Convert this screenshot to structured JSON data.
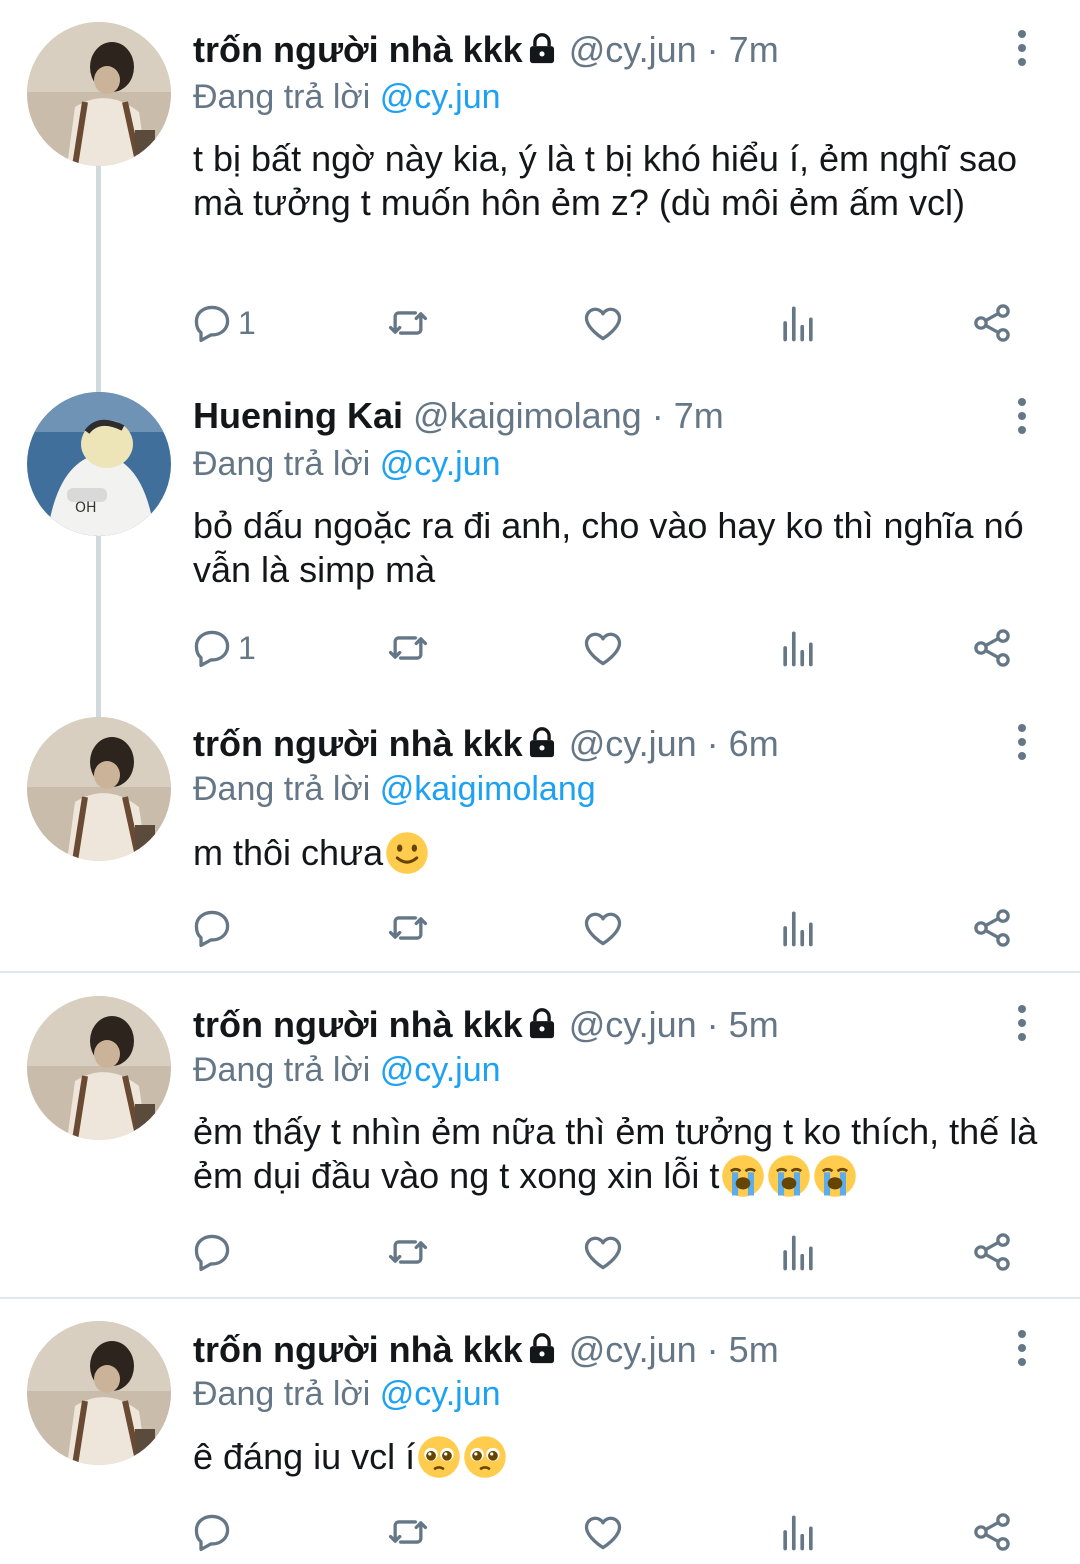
{
  "colors": {
    "accent": "#1da1f2",
    "muted": "#657786",
    "text": "#14171a",
    "divider": "#e1e8ed"
  },
  "tweets": [
    {
      "name": "trốn người nhà kkk",
      "protected_icon": "lock-icon",
      "handle": "@cy.jun",
      "separator": "·",
      "time": "7m",
      "replying_prefix": "Đang trả lời ",
      "replying_to": "@cy.jun",
      "text": "t bị bất ngờ này kia, ý là t bị khó hiểu í, ẻm nghĩ sao mà tưởng t muốn hôn ẻm z? (dù môi ẻm ấm vcl)",
      "emojis": [],
      "reply_count": "1",
      "avatar": "avatar-boy-sepia"
    },
    {
      "name": "Huening Kai",
      "protected_icon": "",
      "handle": "@kaigimolang",
      "separator": "·",
      "time": "7m",
      "replying_prefix": "Đang trả lời ",
      "replying_to": "@cy.jun",
      "text": "bỏ dấu ngoặc ra đi anh, cho vào hay ko thì nghĩa nó vẫn là simp mà",
      "emojis": [],
      "reply_count": "1",
      "avatar": "avatar-blond-white-hoodie"
    },
    {
      "name": "trốn người nhà kkk",
      "protected_icon": "lock-icon",
      "handle": "@cy.jun",
      "separator": "·",
      "time": "6m",
      "replying_prefix": "Đang trả lời ",
      "replying_to": "@kaigimolang",
      "text": "m thôi chưa",
      "emojis": [
        "slightly-smiling-face"
      ],
      "reply_count": "",
      "avatar": "avatar-boy-sepia"
    },
    {
      "name": "trốn người nhà kkk",
      "protected_icon": "lock-icon",
      "handle": "@cy.jun",
      "separator": "·",
      "time": "5m",
      "replying_prefix": "Đang trả lời ",
      "replying_to": "@cy.jun",
      "text": "ẻm thấy t nhìn ẻm nữa thì ẻm tưởng t ko thích, thế là ẻm dụi đầu vào ng t xong xin lỗi t",
      "emojis": [
        "loudly-crying-face",
        "loudly-crying-face",
        "loudly-crying-face"
      ],
      "reply_count": "",
      "avatar": "avatar-boy-sepia"
    },
    {
      "name": "trốn người nhà kkk",
      "protected_icon": "lock-icon",
      "handle": "@cy.jun",
      "separator": "·",
      "time": "5m",
      "replying_prefix": "Đang trả lời ",
      "replying_to": "@cy.jun",
      "text": "ê đáng iu vcl í",
      "emojis": [
        "pleading-face",
        "pleading-face"
      ],
      "reply_count": "",
      "avatar": "avatar-boy-sepia"
    }
  ],
  "action_icons": [
    "reply-icon",
    "retweet-icon",
    "like-icon",
    "analytics-icon",
    "share-icon"
  ],
  "more_icon": "more-vertical-icon"
}
